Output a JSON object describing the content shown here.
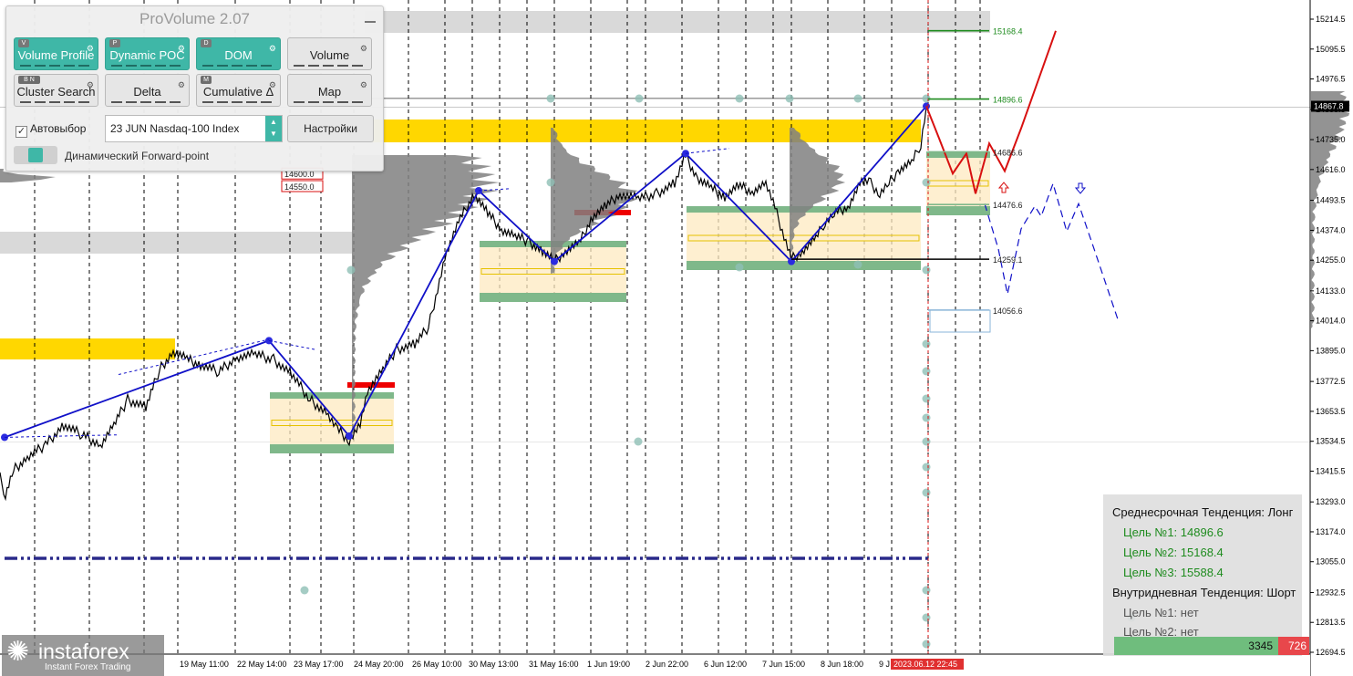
{
  "panel": {
    "title": "ProVolume 2.07",
    "buttons": [
      {
        "key": "V",
        "label": "Volume Profile",
        "on": true
      },
      {
        "key": "P",
        "label": "Dynamic POC",
        "on": true
      },
      {
        "key": "D",
        "label": "DOM",
        "on": true
      },
      {
        "key": "",
        "label": "Volume",
        "on": false
      },
      {
        "key": "B N",
        "label": "Cluster Search",
        "on": false
      },
      {
        "key": "",
        "label": "Delta",
        "on": false
      },
      {
        "key": "M",
        "label": "Cumulative Δ",
        "on": false
      },
      {
        "key": "",
        "label": "Map",
        "on": false
      }
    ],
    "autoselect_label": "Автовыбор",
    "instrument": "23 JUN Nasdaq-100 Index",
    "settings_label": "Настройки",
    "forward_point_label": "Динамический Forward-point"
  },
  "trend_box": {
    "mid_title": "Среднесрочная Тенденция: Лонг",
    "mid_targets": [
      "Цель №1: 14896.6",
      "Цель №2: 15168.4",
      "Цель №3: 15588.4"
    ],
    "intra_title": "Внутридневная Тенденция: Шорт",
    "intra_targets": [
      "Цель №1: нет",
      "Цель №2: нет"
    ]
  },
  "volume_bar": {
    "buy": "3345",
    "sell": "726"
  },
  "logo": {
    "name": "instaforex",
    "tagline": "Instant Forex Trading"
  },
  "chart_data": {
    "type": "line",
    "instrument": "Nasdaq-100 Index",
    "y_axis": {
      "range": [
        12650,
        15260
      ],
      "ticks": [
        "15214.5",
        "15095.5",
        "14976.5",
        "14855.5",
        "14735.0",
        "14616.0",
        "14493.5",
        "14374.0",
        "14255.0",
        "14133.0",
        "14014.0",
        "13895.0",
        "13772.5",
        "13653.5",
        "13534.5",
        "13415.5",
        "13293.0",
        "13174.0",
        "13055.0",
        "12932.5",
        "12813.5",
        "12694.5"
      ],
      "current_price": "14867.8"
    },
    "x_axis": {
      "tick_labels": [
        "19 May 11:00",
        "22 May 14:00",
        "23 May 17:00",
        "24 May 20:00",
        "26 May 10:00",
        "30 May 13:00",
        "31 May 16:00",
        "1 Jun 19:00",
        "2 Jun 22:00",
        "6 Jun 12:00",
        "7 Jun 15:00",
        "8 Jun 18:00",
        "9 J"
      ],
      "current_time": "2023.06.12 22:45"
    },
    "price_path": [
      [
        0,
        13390
      ],
      [
        6,
        13320
      ],
      [
        15,
        13420
      ],
      [
        30,
        13470
      ],
      [
        50,
        13520
      ],
      [
        70,
        13600
      ],
      [
        90,
        13560
      ],
      [
        110,
        13520
      ],
      [
        125,
        13600
      ],
      [
        140,
        13700
      ],
      [
        160,
        13670
      ],
      [
        175,
        13820
      ],
      [
        190,
        13890
      ],
      [
        205,
        13860
      ],
      [
        220,
        13840
      ],
      [
        240,
        13810
      ],
      [
        260,
        13870
      ],
      [
        280,
        13880
      ],
      [
        300,
        13860
      ],
      [
        320,
        13800
      ],
      [
        340,
        13700
      ],
      [
        360,
        13640
      ],
      [
        370,
        13580
      ],
      [
        383,
        13540
      ],
      [
        395,
        13600
      ],
      [
        405,
        13750
      ],
      [
        420,
        13820
      ],
      [
        435,
        13900
      ],
      [
        455,
        13920
      ],
      [
        470,
        13990
      ],
      [
        490,
        14290
      ],
      [
        505,
        14420
      ],
      [
        520,
        14520
      ],
      [
        535,
        14440
      ],
      [
        550,
        14380
      ],
      [
        565,
        14350
      ],
      [
        580,
        14330
      ],
      [
        595,
        14290
      ],
      [
        608,
        14250
      ],
      [
        620,
        14290
      ],
      [
        635,
        14320
      ],
      [
        650,
        14430
      ],
      [
        665,
        14470
      ],
      [
        680,
        14520
      ],
      [
        700,
        14500
      ],
      [
        720,
        14520
      ],
      [
        740,
        14560
      ],
      [
        752,
        14670
      ],
      [
        765,
        14580
      ],
      [
        780,
        14540
      ],
      [
        795,
        14510
      ],
      [
        810,
        14550
      ],
      [
        825,
        14530
      ],
      [
        840,
        14560
      ],
      [
        852,
        14440
      ],
      [
        860,
        14350
      ],
      [
        868,
        14260
      ],
      [
        880,
        14290
      ],
      [
        895,
        14340
      ],
      [
        905,
        14410
      ],
      [
        915,
        14440
      ],
      [
        930,
        14470
      ],
      [
        945,
        14570
      ],
      [
        955,
        14560
      ],
      [
        965,
        14520
      ],
      [
        975,
        14560
      ],
      [
        985,
        14610
      ],
      [
        1000,
        14640
      ],
      [
        1010,
        14720
      ],
      [
        1016,
        14868
      ]
    ],
    "zigzag": [
      [
        5,
        13550
      ],
      [
        295,
        13935
      ],
      [
        383,
        13555
      ],
      [
        525,
        14532
      ],
      [
        608,
        14250
      ],
      [
        752,
        14680
      ],
      [
        868,
        14250
      ],
      [
        1016,
        14868
      ]
    ],
    "levels": [
      {
        "label": "15168.4",
        "value": 15168.4
      },
      {
        "label": "14896.6",
        "value": 14896.6
      },
      {
        "label": "14686.6",
        "value": 14686.6
      },
      {
        "label": "14476.6",
        "value": 14476.6
      },
      {
        "label": "14259.1",
        "value": 14259.1
      },
      {
        "label": "14056.6",
        "value": 14056.6
      },
      {
        "label": "14600.0",
        "value": 14600.0
      },
      {
        "label": "14550.0",
        "value": 14550.0
      }
    ],
    "forecast_long": [
      [
        1016,
        14868
      ],
      [
        1030,
        14740
      ],
      [
        1045,
        14600
      ],
      [
        1060,
        14680
      ],
      [
        1070,
        14520
      ],
      [
        1085,
        14720
      ],
      [
        1102,
        14610
      ],
      [
        1120,
        14780
      ],
      [
        1158,
        15168
      ]
    ],
    "forecast_short": [
      [
        1080,
        14480
      ],
      [
        1095,
        14300
      ],
      [
        1105,
        14120
      ],
      [
        1120,
        14380
      ],
      [
        1135,
        14470
      ],
      [
        1142,
        14430
      ],
      [
        1155,
        14560
      ],
      [
        1170,
        14370
      ],
      [
        1183,
        14480
      ],
      [
        1200,
        14300
      ],
      [
        1226,
        14020
      ]
    ],
    "dash_dot_level": 13065
  }
}
